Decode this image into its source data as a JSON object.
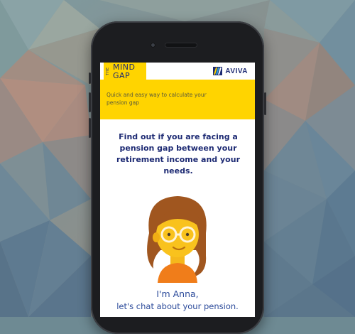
{
  "app": {
    "logo": {
      "line1": "MIND",
      "line2": "THE",
      "line3": "GAP"
    },
    "brand": {
      "name": "AVIVA",
      "icon": "aviva-logo-icon"
    },
    "tagline": "Quick and easy way to calculate your pension gap",
    "headline": "Find out if you are facing a pension gap between your retirement income and your needs.",
    "assistant": {
      "greeting": "I'm Anna,",
      "prompt": "let's chat about your pension.",
      "icon": "anna-avatar-icon"
    }
  },
  "colors": {
    "accent_yellow": "#ffd400",
    "brand_navy": "#1d2a73",
    "text_blue": "#2b4a9a"
  }
}
